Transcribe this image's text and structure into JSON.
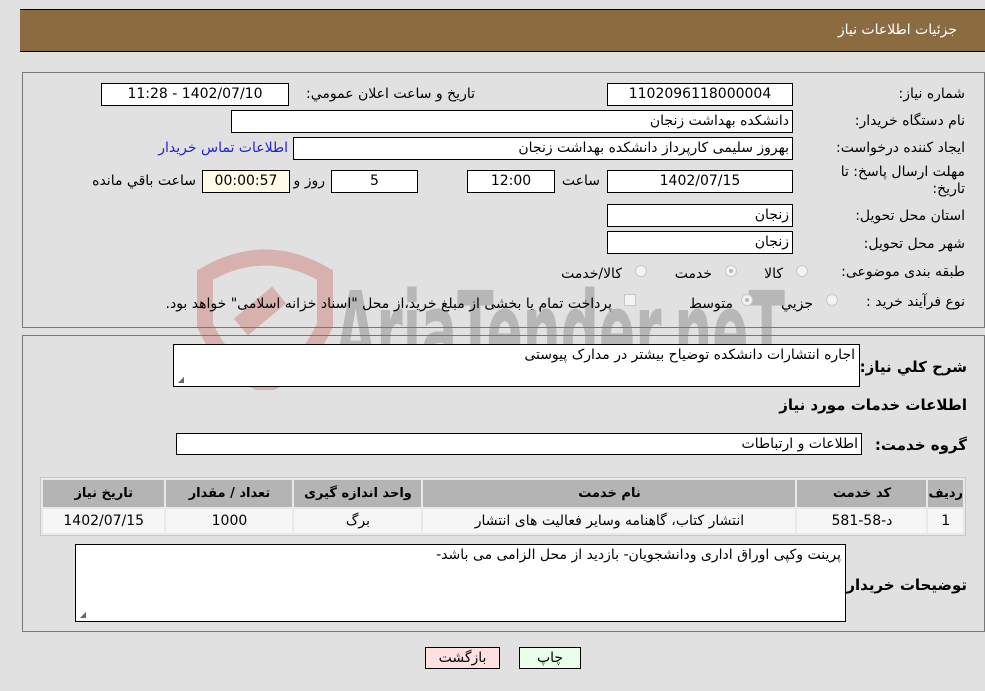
{
  "header": {
    "title": "جزئیات اطلاعات نیاز"
  },
  "form": {
    "need_number": {
      "label": "شماره نیاز:",
      "value": "1102096118000004"
    },
    "announce": {
      "label": "تاریخ و ساعت اعلان عمومي:",
      "value": "1402/07/10 - 11:28"
    },
    "buyer_org": {
      "label": "نام دستگاه خریدار:",
      "value": "دانشکده بهداشت زنجان"
    },
    "requester": {
      "label": "ایجاد کننده درخواست:",
      "value": "بهروز سلیمی کارپرداز دانشکده بهداشت زنجان"
    },
    "contact_link": "اطلاعات تماس خریدار",
    "deadline": {
      "label": "مهلت ارسال پاسخ: تا تاریخ:",
      "date": "1402/07/15",
      "time_label": "ساعت",
      "time": "12:00",
      "days": "5",
      "days_label": "روز و",
      "remaining": "00:00:57",
      "remaining_label": "ساعت باقي مانده"
    },
    "province": {
      "label": "استان محل تحویل:",
      "value": "زنجان"
    },
    "city": {
      "label": "شهر محل تحویل:",
      "value": "زنجان"
    },
    "category": {
      "label": "طبقه بندی موضوعی:",
      "options": [
        "کالا",
        "خدمت",
        "کالا/خدمت"
      ],
      "selected": "خدمت"
    },
    "process": {
      "label": "نوع فرآیند خرید :",
      "options": [
        "جزیي",
        "متوسط"
      ],
      "selected": "متوسط",
      "treasury_note": "پرداخت تمام یا بخشی از مبلغ خرید،از محل \"اسناد خزانه اسلامی\" خواهد بود."
    }
  },
  "details": {
    "summary_label": "شرح کلي نیاز:",
    "summary": "اجاره انتشارات دانشکده توضیاح بیشتر در مدارک پیوستی",
    "services_heading": "اطلاعات خدمات مورد نیاز",
    "service_group_label": "گروه خدمت:",
    "service_group": "اطلاعات و ارتباطات",
    "table": {
      "headers": [
        "ردیف",
        "کد خدمت",
        "نام خدمت",
        "واحد اندازه گیری",
        "تعداد / مقدار",
        "تاریخ نیاز"
      ],
      "rows": [
        [
          "1",
          "د-58-581",
          "انتشار کتاب، گاهنامه وسایر فعالیت های انتشار",
          "برگ",
          "1000",
          "1402/07/15"
        ]
      ]
    },
    "buyer_notes_label": "توضیحات خریدار:",
    "buyer_notes": "پرینت وکپی اوراق اداری ودانشجویان- بازدید از محل الزامی می باشد-"
  },
  "buttons": {
    "print": "چاپ",
    "back": "بازگشت"
  },
  "watermark": "AriaTender.neT",
  "colors": {
    "header": "#8b6b40",
    "print_btn": "#eaffea",
    "back_btn": "#ffe0e0",
    "link": "#2323c8"
  }
}
